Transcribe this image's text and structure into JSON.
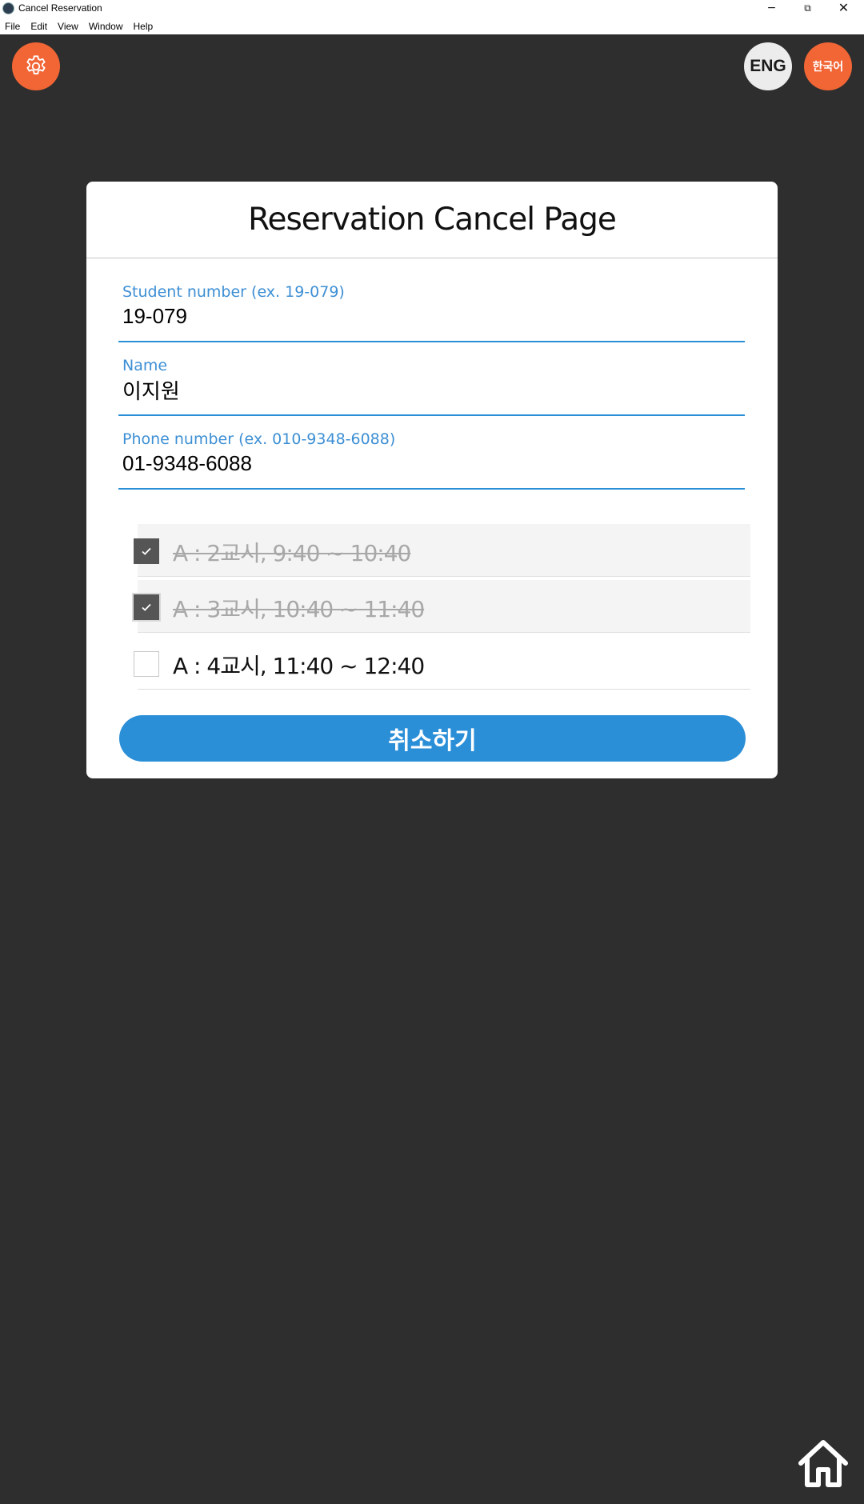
{
  "window": {
    "title": "Cancel Reservation",
    "controls": {
      "minimize": "−",
      "maximize": "⧉",
      "close": "✕"
    }
  },
  "menu": {
    "items": [
      "File",
      "Edit",
      "View",
      "Window",
      "Help"
    ]
  },
  "toolbar": {
    "settings_icon": "gear-icon",
    "lang_eng": "ENG",
    "lang_kor": "한국어"
  },
  "card": {
    "title": "Reservation Cancel Page",
    "fields": [
      {
        "label": "Student number (ex. 19-079)",
        "value": "19-079"
      },
      {
        "label": "Name",
        "value": "이지원"
      },
      {
        "label": "Phone number (ex. 010-9348-6088)",
        "value": "01-9348-6088"
      }
    ],
    "slots": [
      {
        "label": "A : 2교시, 9:40 ~ 10:40",
        "checked": true,
        "disabled": true
      },
      {
        "label": "A : 3교시, 10:40 ~ 11:40",
        "checked": true,
        "disabled": true
      },
      {
        "label": "A : 4교시, 11:40 ~ 12:40",
        "checked": false,
        "disabled": false
      }
    ],
    "submit_label": "취소하기"
  },
  "colors": {
    "background": "#2e2e2e",
    "accent_orange": "#f26535",
    "accent_blue": "#2b8fd8"
  },
  "footer": {
    "home_icon": "home-icon"
  }
}
